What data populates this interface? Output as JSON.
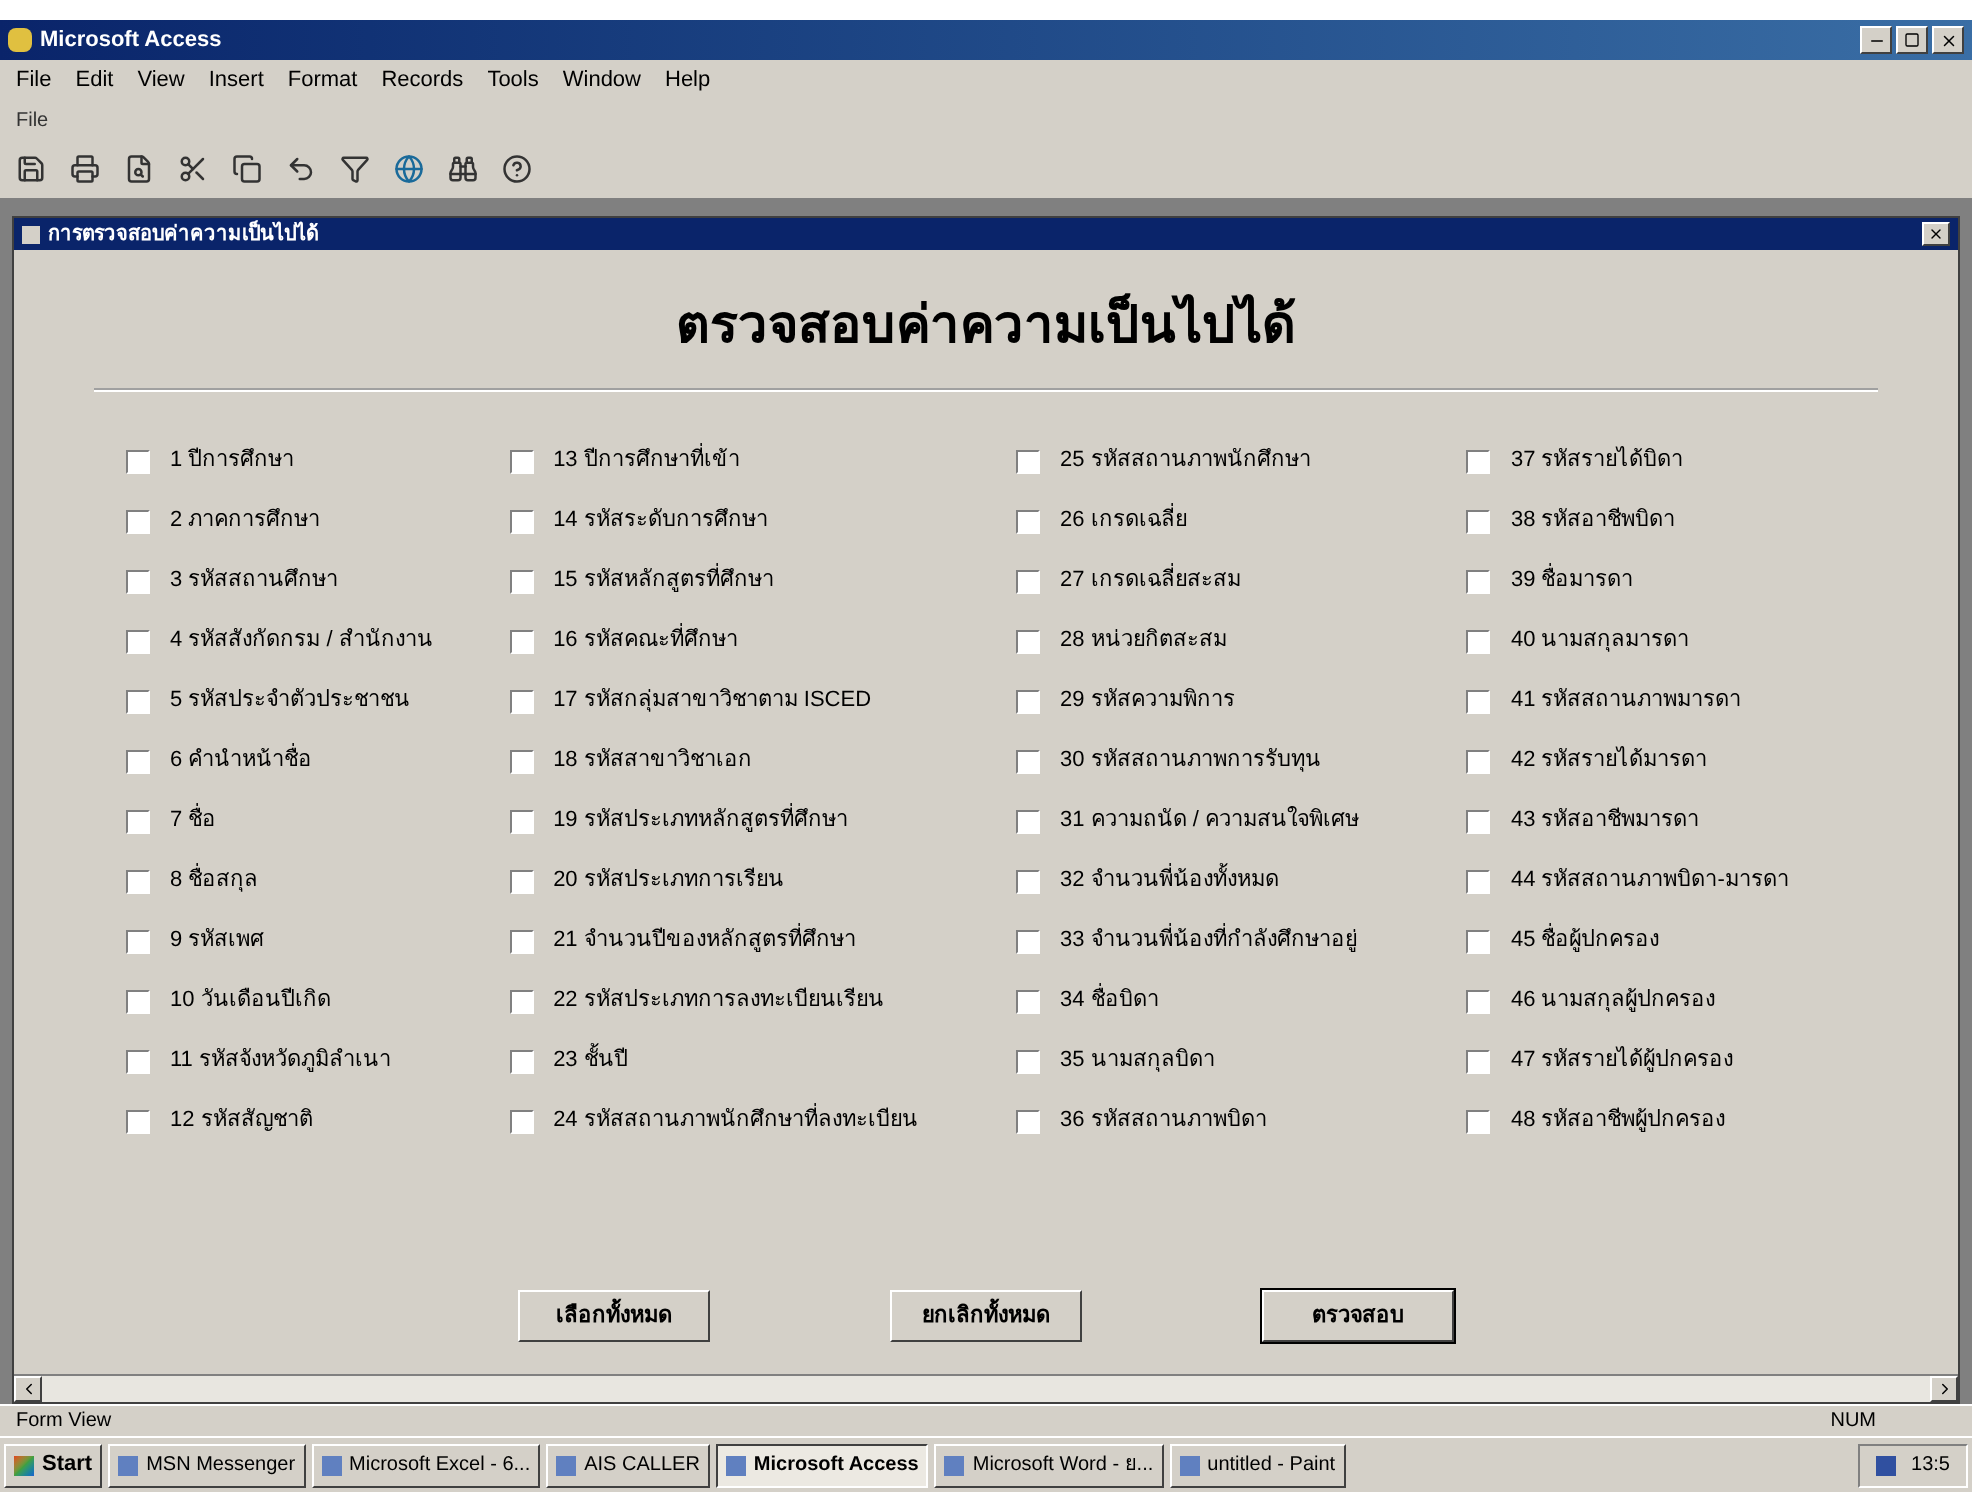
{
  "app_window": {
    "title": "Microsoft Access"
  },
  "menu": [
    "File",
    "Edit",
    "View",
    "Insert",
    "Format",
    "Records",
    "Tools",
    "Window",
    "Help"
  ],
  "toolbar_label": "File",
  "form": {
    "title": "การตรวจสอบค่าความเป็นไปได้",
    "heading": "ตรวจสอบค่าความเป็นไปได้",
    "columns": [
      [
        {
          "label": "1 ปีการศึกษา",
          "checked": false
        },
        {
          "label": "2 ภาคการศึกษา",
          "checked": false
        },
        {
          "label": "3 รหัสสถานศึกษา",
          "checked": false
        },
        {
          "label": "4 รหัสสังกัดกรม / สำนักงาน",
          "checked": false
        },
        {
          "label": "5 รหัสประจำตัวประชาชน",
          "checked": false
        },
        {
          "label": "6 คำนำหน้าชื่อ",
          "checked": false
        },
        {
          "label": "7 ชื่อ",
          "checked": false
        },
        {
          "label": "8 ชื่อสกุล",
          "checked": false
        },
        {
          "label": "9 รหัสเพศ",
          "checked": false
        },
        {
          "label": "10 วันเดือนปีเกิด",
          "checked": false
        },
        {
          "label": "11 รหัสจังหวัดภูมิลำเนา",
          "checked": false
        },
        {
          "label": "12 รหัสสัญชาติ",
          "checked": false
        }
      ],
      [
        {
          "label": "13 ปีการศึกษาที่เข้า",
          "checked": false
        },
        {
          "label": "14 รหัสระดับการศึกษา",
          "checked": false
        },
        {
          "label": "15 รหัสหลักสูตรที่ศึกษา",
          "checked": false
        },
        {
          "label": "16 รหัสคณะที่ศึกษา",
          "checked": false
        },
        {
          "label": "17 รหัสกลุ่มสาขาวิชาตาม ISCED",
          "checked": false
        },
        {
          "label": "18 รหัสสาขาวิชาเอก",
          "checked": false
        },
        {
          "label": "19 รหัสประเภทหลักสูตรที่ศึกษา",
          "checked": false
        },
        {
          "label": "20 รหัสประเภทการเรียน",
          "checked": false
        },
        {
          "label": "21 จำนวนปีของหลักสูตรที่ศึกษา",
          "checked": false
        },
        {
          "label": "22 รหัสประเภทการลงทะเบียนเรียน",
          "checked": false
        },
        {
          "label": "23 ชั้นปี",
          "checked": false
        },
        {
          "label": "24 รหัสสถานภาพนักศึกษาที่ลงทะเบียน",
          "checked": false
        }
      ],
      [
        {
          "label": "25 รหัสสถานภาพนักศึกษา",
          "checked": false
        },
        {
          "label": "26 เกรดเฉลี่ย",
          "checked": false
        },
        {
          "label": "27 เกรดเฉลี่ยสะสม",
          "checked": false
        },
        {
          "label": "28 หน่วยกิตสะสม",
          "checked": false
        },
        {
          "label": "29 รหัสความพิการ",
          "checked": false
        },
        {
          "label": "30 รหัสสถานภาพการรับทุน",
          "checked": false
        },
        {
          "label": "31 ความถนัด / ความสนใจพิเศษ",
          "checked": false
        },
        {
          "label": "32 จำนวนพี่น้องทั้งหมด",
          "checked": false
        },
        {
          "label": "33 จำนวนพี่น้องที่กำลังศึกษาอยู่",
          "checked": false
        },
        {
          "label": "34 ชื่อบิดา",
          "checked": false
        },
        {
          "label": "35 นามสกุลบิดา",
          "checked": false
        },
        {
          "label": "36 รหัสสถานภาพบิดา",
          "checked": false
        }
      ],
      [
        {
          "label": "37 รหัสรายได้บิดา",
          "checked": false
        },
        {
          "label": "38 รหัสอาชีพบิดา",
          "checked": false
        },
        {
          "label": "39 ชื่อมารดา",
          "checked": false
        },
        {
          "label": "40 นามสกุลมารดา",
          "checked": false
        },
        {
          "label": "41 รหัสสถานภาพมารดา",
          "checked": false
        },
        {
          "label": "42 รหัสรายได้มารดา",
          "checked": false
        },
        {
          "label": "43 รหัสอาชีพมารดา",
          "checked": false
        },
        {
          "label": "44 รหัสสถานภาพบิดา-มารดา",
          "checked": false
        },
        {
          "label": "45 ชื่อผู้ปกครอง",
          "checked": false
        },
        {
          "label": "46 นามสกุลผู้ปกครอง",
          "checked": false
        },
        {
          "label": "47 รหัสรายได้ผู้ปกครอง",
          "checked": false
        },
        {
          "label": "48 รหัสอาชีพผู้ปกครอง",
          "checked": false
        }
      ]
    ],
    "buttons": [
      {
        "label": "เลือกทั้งหมด",
        "selected": false
      },
      {
        "label": "ยกเลิกทั้งหมด",
        "selected": false
      },
      {
        "label": "ตรวจสอบ",
        "selected": true
      }
    ]
  },
  "status_bar": {
    "mode": "Form View",
    "indicator": "NUM"
  },
  "taskbar": {
    "start": "Start",
    "items": [
      {
        "label": "MSN Messenger",
        "selected": false
      },
      {
        "label": "Microsoft Excel - 6...",
        "selected": false
      },
      {
        "label": "AIS CALLER",
        "selected": false
      },
      {
        "label": "Microsoft Access",
        "selected": true
      },
      {
        "label": "Microsoft Word - ย...",
        "selected": false
      },
      {
        "label": "untitled - Paint",
        "selected": false
      }
    ],
    "clock": "13:5"
  }
}
